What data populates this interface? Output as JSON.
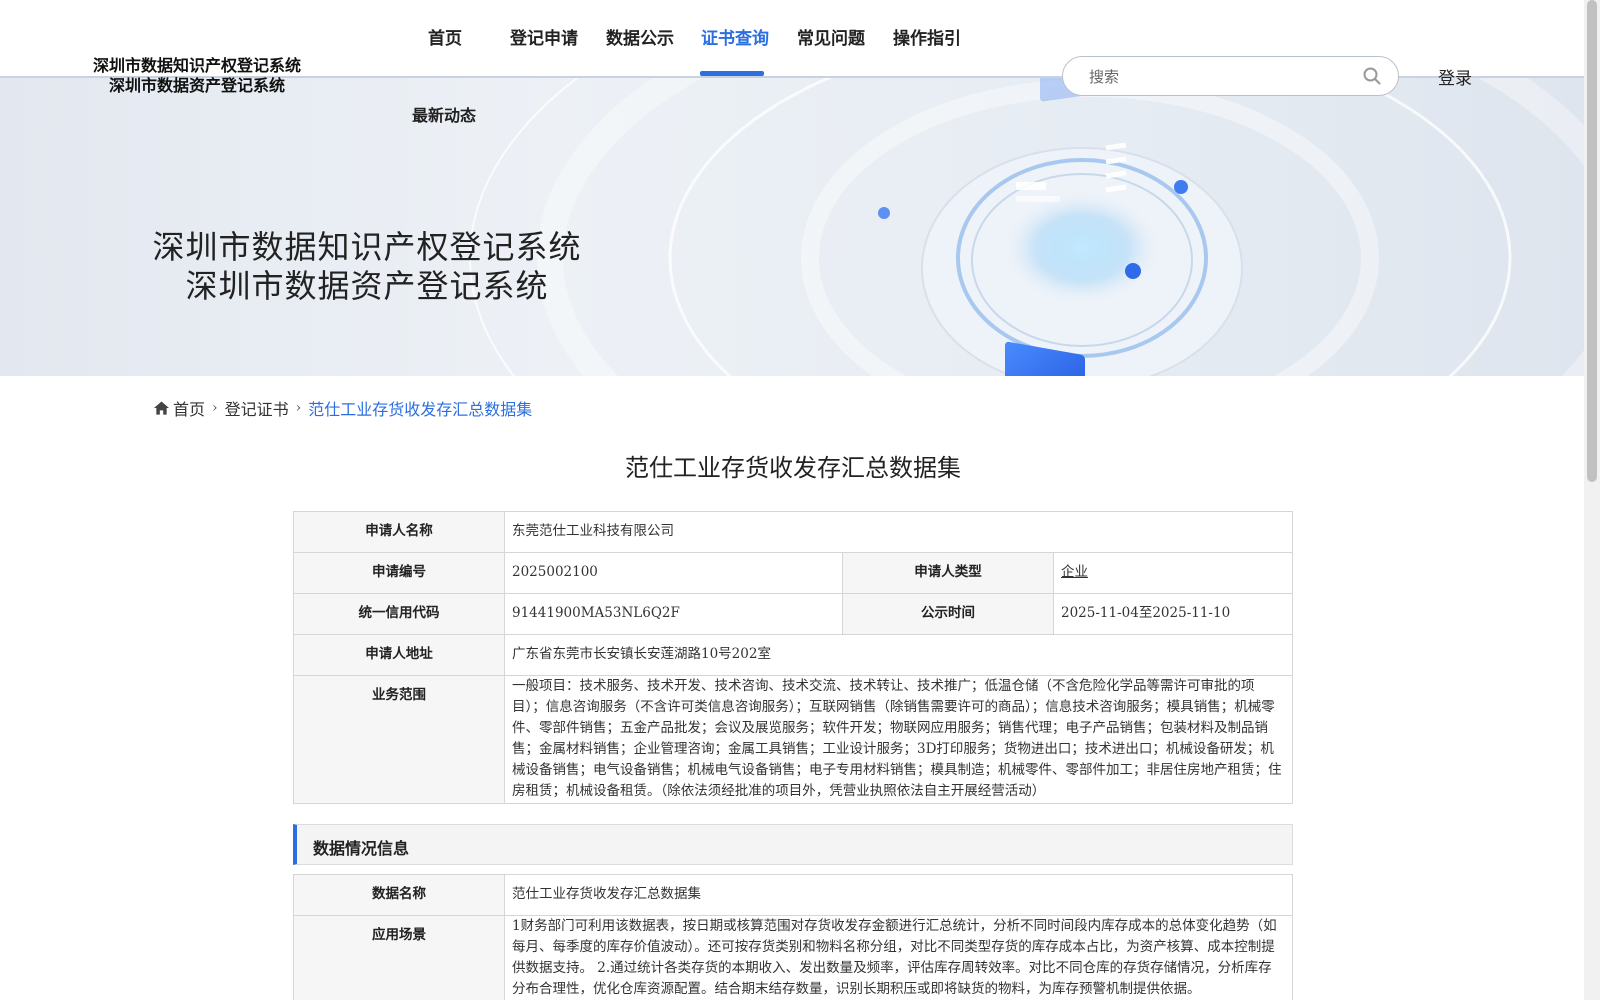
{
  "header": {
    "logo_line1": "深圳市数据知识产权登记系统",
    "logo_line2": "深圳市数据资产登记系统",
    "nav": [
      "首页",
      "登记申请",
      "数据公示",
      "证书查询",
      "常见问题",
      "操作指引"
    ],
    "active_nav": "证书查询",
    "sub_nav": "最新动态",
    "search_placeholder": "搜索",
    "login_label": "登录",
    "accent_color": "#2c6fe0"
  },
  "banner": {
    "title_line1": "深圳市数据知识产权登记系统",
    "title_line2": "深圳市数据资产登记系统"
  },
  "breadcrumb": {
    "home": "首页",
    "level2": "登记证书",
    "current": "范仕工业存货收发存汇总数据集",
    "home_icon": "home-icon",
    "separator_icon": "chevron-right-icon"
  },
  "page_title": "范仕工业存货收发存汇总数据集",
  "applicant": {
    "name_label": "申请人名称",
    "name_value": "东莞范仕工业科技有限公司",
    "app_no_label": "申请编号",
    "app_no_value": "2025002100",
    "type_label": "申请人类型",
    "type_value": "企业",
    "credit_label": "统一信用代码",
    "credit_value": "91441900MA53NL6Q2F",
    "publicity_label": "公示时间",
    "publicity_value": "2025-11-04至2025-11-10",
    "address_label": "申请人地址",
    "address_value": "广东省东莞市长安镇长安莲湖路10号202室",
    "scope_label": "业务范围",
    "scope_value": "一般项目：技术服务、技术开发、技术咨询、技术交流、技术转让、技术推广；低温仓储（不含危险化学品等需许可审批的项目）；信息咨询服务（不含许可类信息咨询服务）；互联网销售（除销售需要许可的商品）；信息技术咨询服务；模具销售；机械零件、零部件销售；五金产品批发；会议及展览服务；软件开发；物联网应用服务；销售代理；电子产品销售；包装材料及制品销售；金属材料销售；企业管理咨询；金属工具销售；工业设计服务；3D打印服务；货物进出口；技术进出口；机械设备研发；机械设备销售；电气设备销售；机械电气设备销售；电子专用材料销售；模具制造；机械零件、零部件加工；非居住房地产租赁；住房租赁；机械设备租赁。（除依法须经批准的项目外，凭营业执照依法自主开展经营活动）"
  },
  "data_section": {
    "title": "数据情况信息",
    "data_name_label": "数据名称",
    "data_name_value": "范仕工业存货收发存汇总数据集",
    "scenario_label": "应用场景",
    "scenario_value": "1财务部门可利用该数据表，按日期或核算范围对存货收发存金额进行汇总统计，分析不同时间段内库存成本的总体变化趋势（如每月、每季度的库存价值波动）。还可按存货类别和物料名称分组，对比不同类型存货的库存成本占比，为资产核算、成本控制提供数据支持。 2.通过统计各类存货的本期收入、发出数量及频率，评估库存周转效率。对比不同仓库的存货存储情况，分析库存分布合理性，优化仓库资源配置。结合期末结存数量，识别长期积压或即将缺货的物料，为库存预警机制提供依据。"
  }
}
